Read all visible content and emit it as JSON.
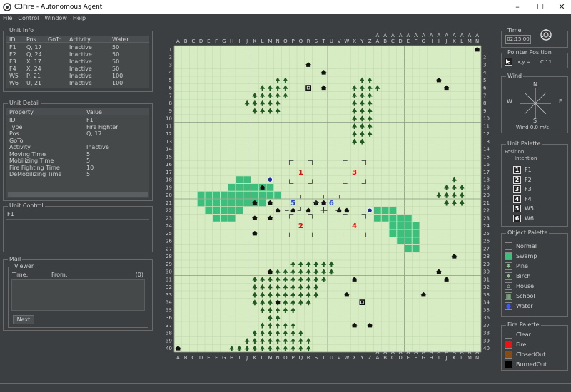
{
  "window": {
    "title": "C3Fire - Autonomous Agent"
  },
  "menu": [
    "File",
    "Control",
    "Window",
    "Help"
  ],
  "unit_info": {
    "title": "Unit Info",
    "headers": [
      "ID",
      "Pos",
      "GoTo",
      "Activity",
      "Water"
    ],
    "rows": [
      [
        "F1",
        "Q, 17",
        "",
        "Inactive",
        "50"
      ],
      [
        "F2",
        "Q, 24",
        "",
        "Inactive",
        "50"
      ],
      [
        "F3",
        "X, 17",
        "",
        "Inactive",
        "50"
      ],
      [
        "F4",
        "X, 24",
        "",
        "Inactive",
        "50"
      ],
      [
        "W5",
        "P, 21",
        "",
        "Inactive",
        "100"
      ],
      [
        "W6",
        "U, 21",
        "",
        "Inactive",
        "100"
      ]
    ]
  },
  "unit_detail": {
    "title": "Unit Detail",
    "headers": [
      "Property",
      "Value"
    ],
    "rows": [
      [
        "ID",
        "F1"
      ],
      [
        "Type",
        "Fire Fighter"
      ],
      [
        "Pos",
        "Q, 17"
      ],
      [
        "GoTo",
        ""
      ],
      [
        "Activity",
        "Inactive"
      ],
      [
        "Moving Time",
        "5"
      ],
      [
        "Mobilizing Time",
        "5"
      ],
      [
        "Fire Fighting Time",
        "10"
      ],
      [
        "DeMobilizing Time",
        "5"
      ]
    ]
  },
  "unit_control": {
    "title": "Unit Control",
    "value": "F1"
  },
  "mail": {
    "title": "Mail",
    "viewer": "Viewer",
    "time_label": "Time:",
    "from_label": "From:",
    "count": "(0)",
    "next_label": "Next"
  },
  "time": {
    "title": "Time",
    "value": "02:15:00"
  },
  "pointer": {
    "title": "Pointer Position",
    "label": "x,y =",
    "value": "C 11"
  },
  "wind": {
    "title": "Wind",
    "n": "N",
    "s": "S",
    "e": "E",
    "w": "W",
    "value": "Wind 0.0 m/s"
  },
  "unit_palette": {
    "title": "Unit Palette",
    "position": "Position",
    "intention": "Intention",
    "items": [
      {
        "num": "1",
        "label": "F1"
      },
      {
        "num": "2",
        "label": "F2"
      },
      {
        "num": "3",
        "label": "F3"
      },
      {
        "num": "4",
        "label": "F4"
      },
      {
        "num": "5",
        "label": "W5"
      },
      {
        "num": "6",
        "label": "W6"
      }
    ]
  },
  "object_palette": {
    "title": "Object Palette",
    "items": [
      {
        "label": "Normal",
        "color": "#3c3f41"
      },
      {
        "label": "Swamp",
        "color": "#3cbf7c"
      },
      {
        "label": "Pine",
        "color": "#2a5a2a"
      },
      {
        "label": "Birch",
        "color": "#2a5a2a"
      },
      {
        "label": "House",
        "color": "#111111"
      },
      {
        "label": "School",
        "color": "#111111"
      },
      {
        "label": "Water",
        "color": "#1a2a9a"
      }
    ]
  },
  "fire_palette": {
    "title": "Fire Palette",
    "items": [
      {
        "label": "Clear",
        "color": "#3c3f41"
      },
      {
        "label": "Fire",
        "color": "#ee1111"
      },
      {
        "label": "ClosedOut",
        "color": "#8a4a10"
      },
      {
        "label": "BurnedOut",
        "color": "#000000"
      }
    ]
  },
  "map": {
    "cols": [
      "A",
      "B",
      "C",
      "D",
      "E",
      "F",
      "G",
      "H",
      "I",
      "J",
      "K",
      "L",
      "M",
      "N",
      "O",
      "P",
      "Q",
      "R",
      "S",
      "T",
      "U",
      "V",
      "W",
      "X",
      "Y",
      "Z",
      "AA",
      "AB",
      "AC",
      "AD",
      "AE",
      "AF",
      "AG",
      "AH",
      "AI",
      "AJ",
      "AK",
      "AL",
      "AM",
      "AN"
    ],
    "rows": 40,
    "ground_color": "#d8ecc4",
    "swamp_color": "#3cbf7c",
    "fire_units": [
      {
        "label": "1",
        "col": "Q",
        "row": 17
      },
      {
        "label": "2",
        "col": "Q",
        "row": 24
      },
      {
        "label": "3",
        "col": "X",
        "row": 17
      },
      {
        "label": "4",
        "col": "X",
        "row": 24
      }
    ],
    "water_units": [
      {
        "label": "5",
        "col": "P",
        "row": 21
      },
      {
        "label": "6",
        "col": "U",
        "row": 21
      }
    ]
  }
}
